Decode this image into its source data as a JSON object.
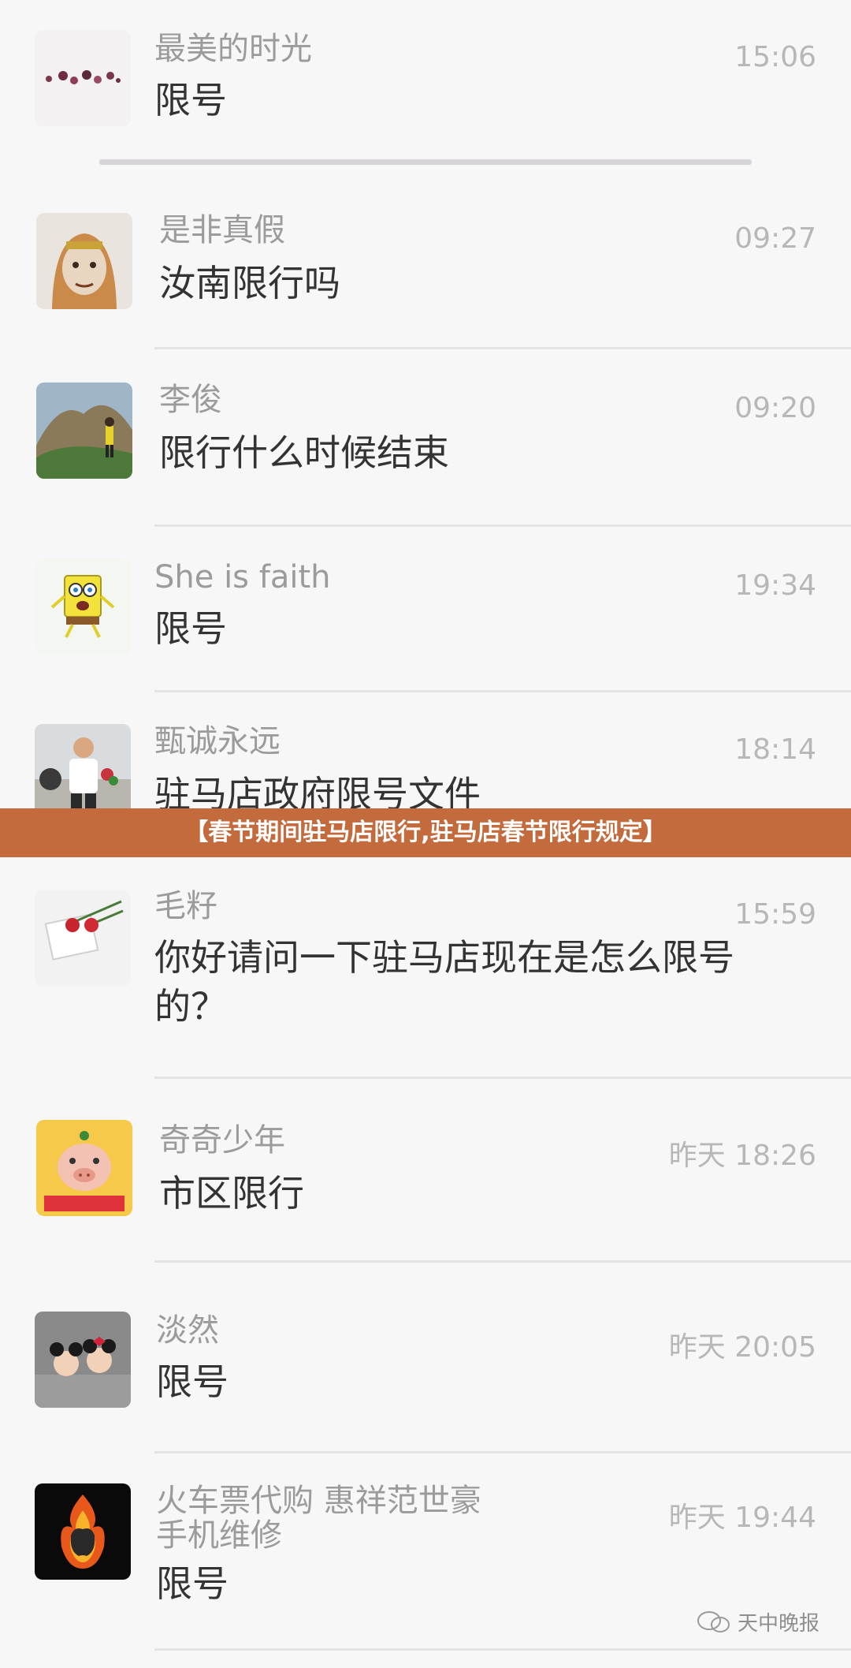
{
  "chats": [
    {
      "name": "最美的时光",
      "message": "限号",
      "time": "15:06",
      "avatar": "dried-flowers-avatar"
    },
    {
      "name": "是非真假",
      "message": "汝南限行吗",
      "time": "09:27",
      "avatar": "monkey-king-avatar"
    },
    {
      "name": "李俊",
      "message": "限行什么时候结束",
      "time": "09:20",
      "avatar": "mountain-photo-avatar"
    },
    {
      "name": "She is faith",
      "message": "限号",
      "time": "19:34",
      "avatar": "spongebob-avatar"
    },
    {
      "name": "甄诚永远",
      "message": "驻马店政府限号文件",
      "time": "18:14",
      "avatar": "man-with-flowers-avatar"
    },
    {
      "name": "毛籽",
      "message": "你好请问一下驻马店现在是怎么限号的？",
      "time": "15:59",
      "avatar": "red-carnations-avatar"
    },
    {
      "name": "奇奇少年",
      "message": "市区限行",
      "time": "昨天 18:26",
      "avatar": "piggy-avatar"
    },
    {
      "name": "淡然",
      "message": "限号",
      "time": "昨天 20:05",
      "avatar": "mickey-minnie-avatar"
    },
    {
      "name": "火车票代购 惠祥范世豪\n手机维修",
      "message": "限号",
      "time": "昨天 19:44",
      "avatar": "flaming-apple-avatar"
    }
  ],
  "banner": "【春节期间驻马店限行,驻马店春节限行规定】",
  "watermark": "天中晚报",
  "colors": {
    "banner_bg": "#c46b3e",
    "name_text": "#9b9b9b",
    "message_text": "#333333",
    "time_text": "#b7b7b7"
  }
}
